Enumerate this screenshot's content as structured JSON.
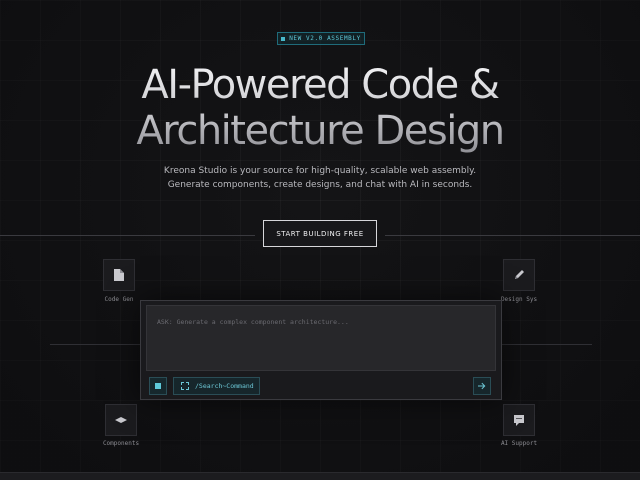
{
  "badge": {
    "label": "NEW V2.0 ASSEMBLY"
  },
  "hero": {
    "title_line1": "AI-Powered Code &",
    "title_line2": "Architecture Design",
    "subtitle_line1": "Kreona Studio is your source for high-quality, scalable web assembly.",
    "subtitle_line2": "Generate components, create designs, and chat with AI in seconds."
  },
  "cta": {
    "label": "START BUILDING FREE"
  },
  "features": [
    {
      "label": "Code Gen",
      "icon": "document-icon"
    },
    {
      "label": "Design Sys",
      "icon": "pencil-icon"
    },
    {
      "label": "Components",
      "icon": "component-icon"
    },
    {
      "label": "AI Support",
      "icon": "chat-icon"
    }
  ],
  "composer": {
    "placeholder": "ASK: Generate a complex component architecture...",
    "command_label": "/Search~Command",
    "send_icon": "arrow-right-icon",
    "tool_icon": "cube-icon"
  },
  "colors": {
    "background": "#141416",
    "accent": "#5fc9d9",
    "cta_border": "#d6d6da"
  }
}
